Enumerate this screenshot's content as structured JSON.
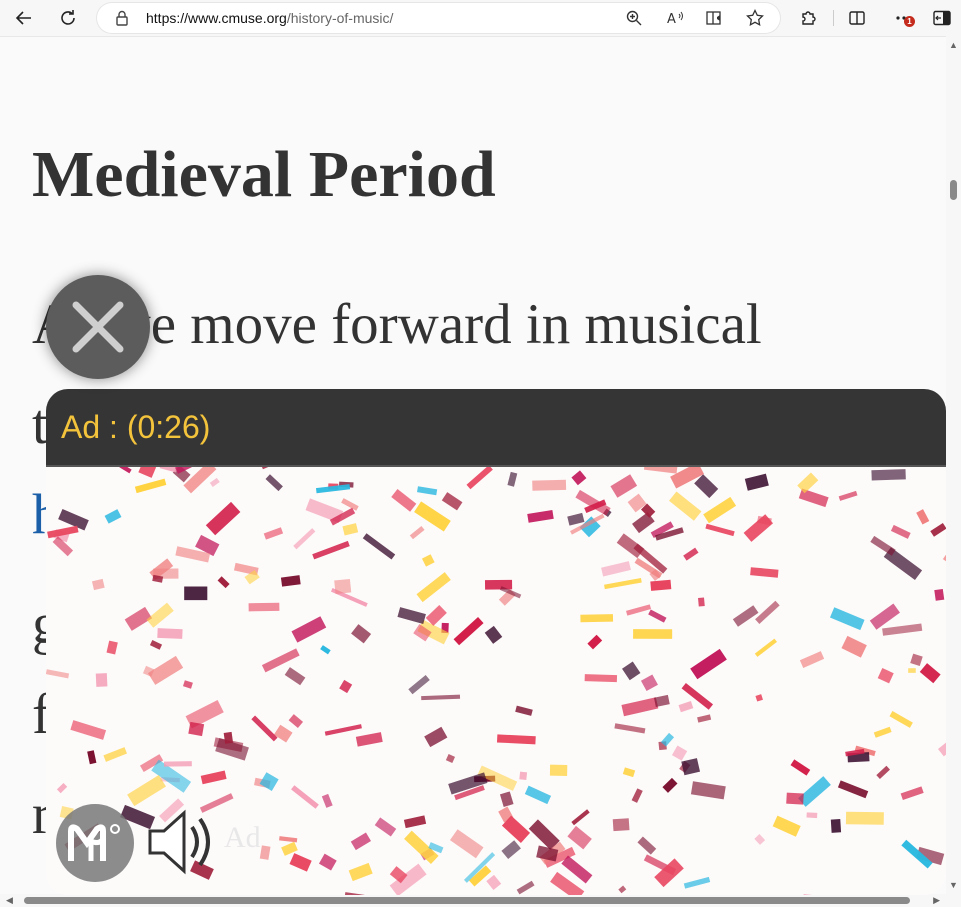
{
  "browser": {
    "url_domain": "https://www.cmuse.org",
    "url_path": "/history-of-music/",
    "notification_count": "1",
    "icons": [
      "back-arrow-icon",
      "refresh-icon",
      "lock-icon",
      "zoom-icon",
      "read-aloud-icon",
      "immersive-reader-icon",
      "favorite-star-icon",
      "extensions-icon",
      "split-screen-icon",
      "more-icon",
      "sidebar-icon"
    ]
  },
  "article": {
    "heading": "Medieval Period",
    "lines": [
      "As we move forward in musical",
      "t",
      "h",
      "g",
      "f",
      "r"
    ]
  },
  "ad": {
    "timer": "Ad : (0:26)",
    "label": "Ad",
    "accent_color": "#f3c33c"
  }
}
